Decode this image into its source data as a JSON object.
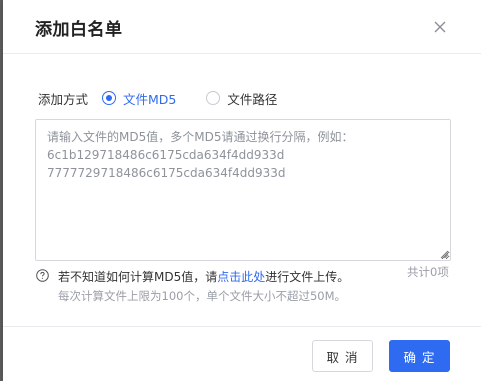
{
  "dialog": {
    "title": "添加白名单",
    "close_icon": "close-icon"
  },
  "mode": {
    "label": "添加方式",
    "options": [
      {
        "label": "文件MD5",
        "checked": true
      },
      {
        "label": "文件路径",
        "checked": false
      }
    ]
  },
  "textarea": {
    "placeholder": "请输入文件的MD5值，多个MD5请通过换行分隔，例如：\n6c1b129718486c6175cda634f4dd933d\n7777729718486c6175cda634f4dd933d",
    "value": ""
  },
  "count_text": "共计0项",
  "hint": {
    "icon": "question-circle-icon",
    "text_before": "若不知道如何计算MD5值，请",
    "link": "点击此处",
    "text_after": "进行文件上传。",
    "limit": "每次计算文件上限为100个，单个文件大小不超过50M。"
  },
  "footer": {
    "cancel_label": "取 消",
    "confirm_label": "确 定"
  },
  "colors": {
    "accent": "#2f6bf0"
  }
}
